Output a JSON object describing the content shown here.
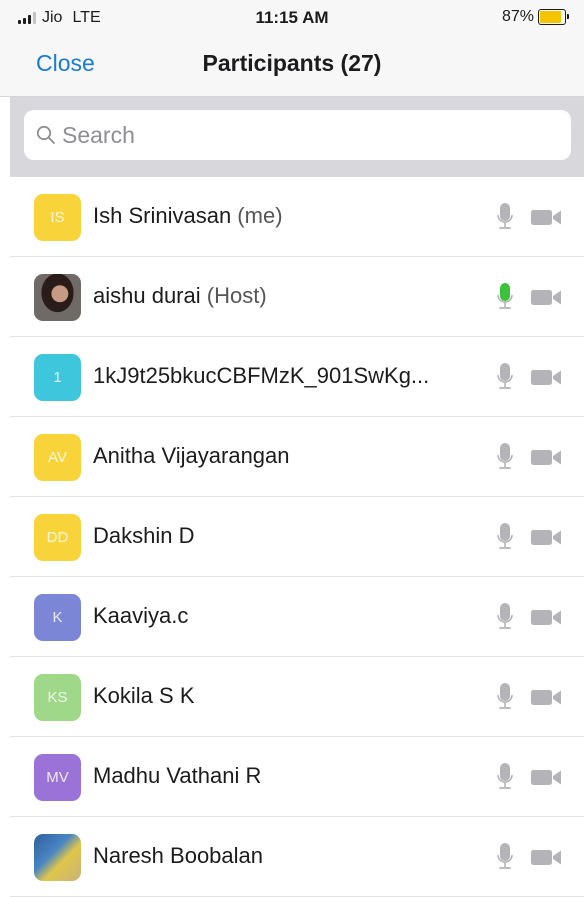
{
  "status_bar": {
    "carrier": "Jio",
    "network": "LTE",
    "time": "11:15 AM",
    "battery": "87%",
    "battery_level": 0.87,
    "battery_color": "#f5c400"
  },
  "nav": {
    "close_label": "Close",
    "title": "Participants (27)",
    "accent_color": "#1a7bd6"
  },
  "search": {
    "placeholder": "Search",
    "icon": "search-icon"
  },
  "participants": [
    {
      "initials": "IS",
      "name": "Ish Srinivasan",
      "role": "(me)",
      "avatar_color": "#f9d33a",
      "photo": false,
      "mic_active": false
    },
    {
      "initials": "",
      "name": "aishu durai",
      "role": "(Host)",
      "avatar_color": "#4a3a34",
      "photo": true,
      "mic_active": true
    },
    {
      "initials": "1",
      "name": "1kJ9t25bkucCBFMzK_901SwKg...",
      "role": "",
      "avatar_color": "#3ec6dc",
      "photo": false,
      "mic_active": false
    },
    {
      "initials": "AV",
      "name": "Anitha Vijayarangan",
      "role": "",
      "avatar_color": "#f9d33a",
      "photo": false,
      "mic_active": false
    },
    {
      "initials": "DD",
      "name": "Dakshin D",
      "role": "",
      "avatar_color": "#f9d33a",
      "photo": false,
      "mic_active": false
    },
    {
      "initials": "K",
      "name": "Kaaviya.c",
      "role": "",
      "avatar_color": "#7b86d6",
      "photo": false,
      "mic_active": false
    },
    {
      "initials": "KS",
      "name": "Kokila S K",
      "role": "",
      "avatar_color": "#9fd889",
      "photo": false,
      "mic_active": false
    },
    {
      "initials": "MV",
      "name": "Madhu Vathani R",
      "role": "",
      "avatar_color": "#9b72d8",
      "photo": false,
      "mic_active": false
    },
    {
      "initials": "",
      "name": "Naresh Boobalan",
      "role": "",
      "avatar_color": "#3d6fa8",
      "photo": true,
      "mic_active": false
    }
  ],
  "icons": {
    "mic": "microphone-icon",
    "video": "video-camera-icon",
    "mic_active_color": "#3bc13b",
    "mic_idle_color": "#b4b4b8",
    "video_color": "#b4b4b8"
  }
}
